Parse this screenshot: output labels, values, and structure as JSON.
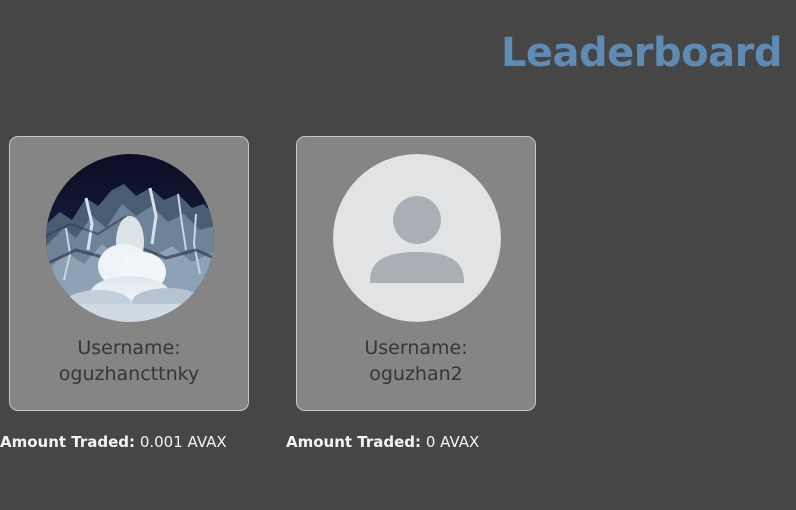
{
  "page": {
    "title": "Leaderboard"
  },
  "leaderboard": {
    "entries": [
      {
        "username_label": "Username:",
        "username": "oguzhancttnky",
        "amount_label": "Amount Traded:",
        "amount_value": "0.001 AVAX",
        "avatar": "mountain-avalanche-photo"
      },
      {
        "username_label": "Username:",
        "username": "oguzhan2",
        "amount_label": "Amount Traded:",
        "amount_value": "0 AVAX",
        "avatar": "default-user-avatar-icon"
      }
    ]
  },
  "colors": {
    "background": "#464646",
    "title": "#5f8ab4",
    "card": "#858585",
    "card_border": "#c8c8c8",
    "amount_text": "#f4f4f4"
  }
}
